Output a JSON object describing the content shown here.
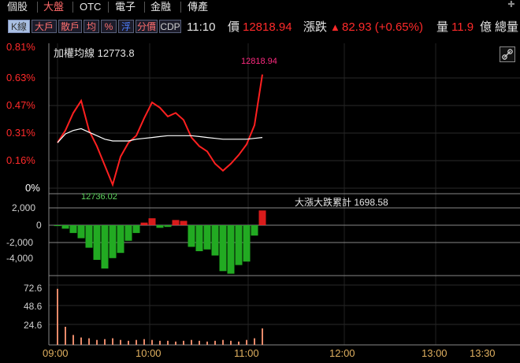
{
  "tabs": [
    {
      "label": "個股",
      "active": false
    },
    {
      "label": "大盤",
      "active": true
    },
    {
      "label": "OTC",
      "active": false
    },
    {
      "label": "電子",
      "active": false
    },
    {
      "label": "金融",
      "active": false
    },
    {
      "label": "傳產",
      "active": false
    }
  ],
  "toolbar_buttons": [
    {
      "label": "K線",
      "style": "k"
    },
    {
      "label": "大戶",
      "style": "normal"
    },
    {
      "label": "散戶",
      "style": "normal"
    },
    {
      "label": "均",
      "style": "normal"
    },
    {
      "label": "%",
      "style": "normal"
    },
    {
      "label": "浮",
      "style": "blue"
    },
    {
      "label": "分價",
      "style": "normal"
    },
    {
      "label": "CDP",
      "style": "gray"
    }
  ],
  "info": {
    "time": "11:10",
    "price_label": "價",
    "price": "12818.94",
    "change_label": "漲跌",
    "change_arrow": "▲",
    "change": "82.93 (+0.65%)",
    "volume_label": "量",
    "volume": "11.9",
    "volume_unit": "億",
    "total_label": "總量"
  },
  "colors": {
    "up": "#ff2020",
    "down": "#22aa22",
    "avg_line": "#ffffff",
    "accent_high": "#ff2a80",
    "low_label": "#5fd45f"
  },
  "main_chart": {
    "avg_label": "加權均線 12773.8",
    "high_label": "12818.94",
    "low_label": "12736.02",
    "y_tick_labels": [
      "0.81%",
      "0.63%",
      "0.47%",
      "0.31%",
      "0.16%",
      "0%"
    ]
  },
  "breadth_chart": {
    "label": "大漲大跌累計 1698.58",
    "y_tick_labels": [
      "2,000",
      "0",
      "-2,000",
      "-4,000"
    ]
  },
  "volume_chart": {
    "y_tick_labels": [
      "72.6",
      "48.6",
      "24.6"
    ]
  },
  "x_tick_labels": [
    "09:00",
    "10:00",
    "11:00",
    "12:00",
    "13:00",
    "13:30"
  ],
  "chart_data": [
    {
      "type": "line",
      "title": "加權均線 12773.8",
      "x": [
        "09:00",
        "09:05",
        "09:10",
        "09:15",
        "09:20",
        "09:25",
        "09:30",
        "09:35",
        "09:40",
        "09:45",
        "09:50",
        "09:55",
        "10:00",
        "10:05",
        "10:10",
        "10:15",
        "10:20",
        "10:25",
        "10:30",
        "10:35",
        "10:40",
        "10:45",
        "10:50",
        "10:55",
        "11:00",
        "11:05",
        "11:10"
      ],
      "series": [
        {
          "name": "price_pct",
          "values": [
            0.26,
            0.33,
            0.43,
            0.5,
            0.33,
            0.24,
            0.13,
            0.02,
            0.18,
            0.26,
            0.3,
            0.4,
            0.49,
            0.46,
            0.41,
            0.43,
            0.39,
            0.29,
            0.24,
            0.21,
            0.14,
            0.1,
            0.14,
            0.19,
            0.25,
            0.36,
            0.65
          ]
        },
        {
          "name": "avg_pct",
          "values": [
            0.26,
            0.31,
            0.33,
            0.34,
            0.32,
            0.3,
            0.28,
            0.27,
            0.27,
            0.27,
            0.28,
            0.285,
            0.29,
            0.295,
            0.3,
            0.3,
            0.3,
            0.3,
            0.295,
            0.29,
            0.285,
            0.28,
            0.28,
            0.28,
            0.28,
            0.285,
            0.29
          ]
        }
      ],
      "ylim": [
        0,
        0.81
      ]
    },
    {
      "type": "bar",
      "title": "大漲大跌累計 1698.58",
      "x": [
        "09:00",
        "09:05",
        "09:10",
        "09:15",
        "09:20",
        "09:25",
        "09:30",
        "09:35",
        "09:40",
        "09:45",
        "09:50",
        "09:55",
        "10:00",
        "10:05",
        "10:10",
        "10:15",
        "10:20",
        "10:25",
        "10:30",
        "10:35",
        "10:40",
        "10:45",
        "10:50",
        "10:55",
        "11:00",
        "11:05",
        "11:10"
      ],
      "values": [
        -100,
        -400,
        -900,
        -1500,
        -2600,
        -4000,
        -5000,
        -3800,
        -3200,
        -1800,
        -900,
        300,
        800,
        -300,
        -200,
        600,
        500,
        -2500,
        -3000,
        -2800,
        -3500,
        -5300,
        -5600,
        -4600,
        -4200,
        -1200,
        1700
      ],
      "ylim": [
        -6000,
        2700
      ]
    },
    {
      "type": "bar",
      "title": "",
      "x": [
        "09:00",
        "09:05",
        "09:10",
        "09:15",
        "09:20",
        "09:25",
        "09:30",
        "09:35",
        "09:40",
        "09:45",
        "09:50",
        "09:55",
        "10:00",
        "10:05",
        "10:10",
        "10:15",
        "10:20",
        "10:25",
        "10:30",
        "10:35",
        "10:40",
        "10:45",
        "10:50",
        "10:55",
        "11:00",
        "11:05",
        "11:10"
      ],
      "values": [
        68,
        22,
        12,
        9,
        8,
        6,
        7,
        8,
        6,
        5,
        6,
        7,
        6,
        5,
        5,
        4,
        5,
        6,
        5,
        4,
        5,
        6,
        5,
        4,
        6,
        8,
        20
      ],
      "ylim": [
        0,
        85
      ]
    }
  ]
}
